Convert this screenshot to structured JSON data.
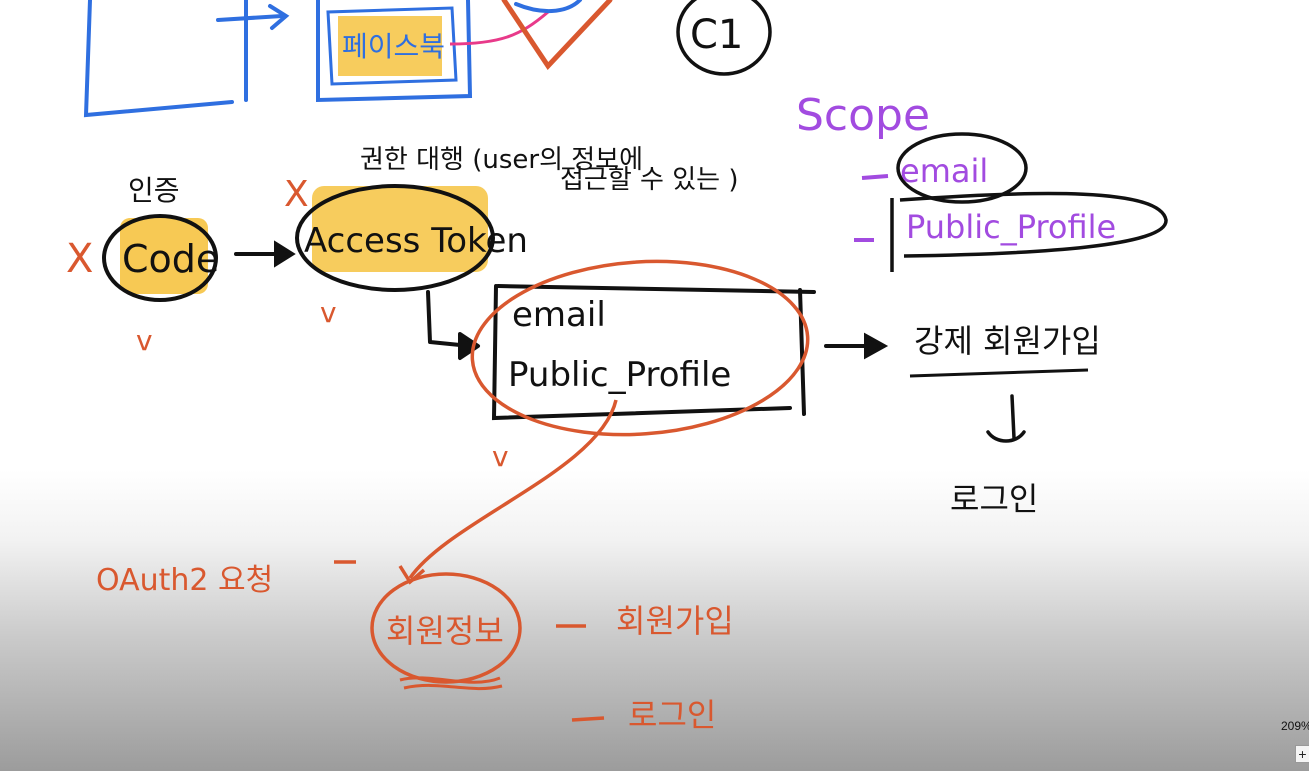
{
  "top": {
    "facebook_label": "페이스북",
    "c1_label": "C1"
  },
  "auth": {
    "auth_label": "인증",
    "code_label": "Code",
    "access_token_label": "Access Token",
    "annotation_line1": "권한 대행 (user의 정보에",
    "annotation_line2": "접근할 수 있는 )",
    "x_mark": "X",
    "v_mark": "v"
  },
  "scope": {
    "title": "Scope",
    "items": [
      "email",
      "Public_Profile"
    ]
  },
  "info_box": {
    "lines": [
      "email",
      "Public_Profile"
    ]
  },
  "flow_right": {
    "forced_signup": "강제 회원가입",
    "login": "로그인"
  },
  "bottom": {
    "oauth_request": "OAuth2 요청",
    "member_info": "회원정보",
    "signup": "회원가입",
    "login": "로그인"
  },
  "zoom": {
    "level": "209%",
    "plus_label": "+"
  },
  "colors": {
    "blue": "#2f6fe0",
    "black": "#111111",
    "orange": "#d9582f",
    "purple": "#a24be0",
    "highlight_yellow": "#f6c341",
    "pink": "#e83a8a"
  }
}
